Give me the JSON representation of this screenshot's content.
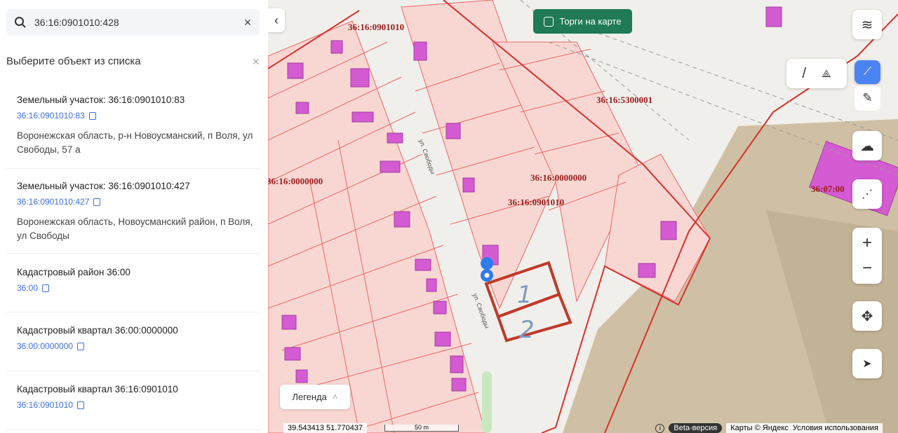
{
  "search": {
    "value": "36:16:0901010:428",
    "clear": "×"
  },
  "list": {
    "title": "Выберите объект из списка",
    "close": "×",
    "items": [
      {
        "title": "Земельный участок: 36:16:0901010:83",
        "code": "36:16:0901010:83",
        "address": "Воронежская область, р-н Новоусманский, п Воля, ул Свободы, 57 а"
      },
      {
        "title": "Земельный участок: 36:16:0901010:427",
        "code": "36:16:0901010:427",
        "address": "Воронежская область, Новоусманский район, п Воля, ул Свободы"
      },
      {
        "title": "Кадастровый район 36:00",
        "code": "36:00"
      },
      {
        "title": "Кадастровый квартал 36:00:0000000",
        "code": "36:00:0000000"
      },
      {
        "title": "Кадастровый квартал 36:16:0901010",
        "code": "36:16:0901010"
      }
    ]
  },
  "map": {
    "torgi": "Торги на карте",
    "legend": "Легенда",
    "coords": "39.543413  51.770437",
    "scale": "50 m",
    "beta": "Beta-версия",
    "attribution": "Карты © Яндекс",
    "terms": "Условия использования",
    "labels": {
      "q1": "36:16:0901010",
      "q2": "36:16:5300001",
      "q3": "36:16:0000000",
      "q4": "36:16:0000000",
      "q5": "36:16:0901010",
      "q6": "36:07:00"
    },
    "street": "ул. Свободы",
    "parcels": [
      "1",
      "2"
    ],
    "zoom_in": "+",
    "zoom_out": "−"
  }
}
